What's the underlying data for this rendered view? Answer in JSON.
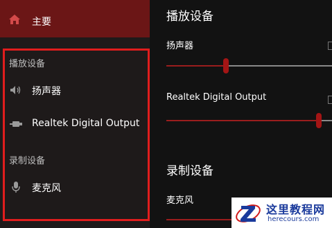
{
  "sidebar": {
    "home_label": "主要",
    "playback_section": "播放设备",
    "playback_devices": [
      {
        "label": "扬声器",
        "icon": "speaker-icon"
      },
      {
        "label": "Realtek Digital Output",
        "icon": "digital-output-icon"
      }
    ],
    "recording_section": "录制设备",
    "recording_devices": [
      {
        "label": "麦克风",
        "icon": "microphone-icon"
      }
    ]
  },
  "main": {
    "playback_heading": "播放设备",
    "playback": [
      {
        "name": "扬声器",
        "volume": 0.36
      },
      {
        "name": "Realtek Digital Output",
        "volume": 0.92
      }
    ],
    "recording_heading": "录制设备",
    "recording": [
      {
        "name": "麦克风"
      }
    ]
  },
  "watermark": {
    "title": "这里教程网",
    "url": "herecours.com"
  },
  "colors": {
    "accent": "#a31515",
    "home_bg": "#6b1616",
    "highlight_border": "#e11d1d"
  }
}
